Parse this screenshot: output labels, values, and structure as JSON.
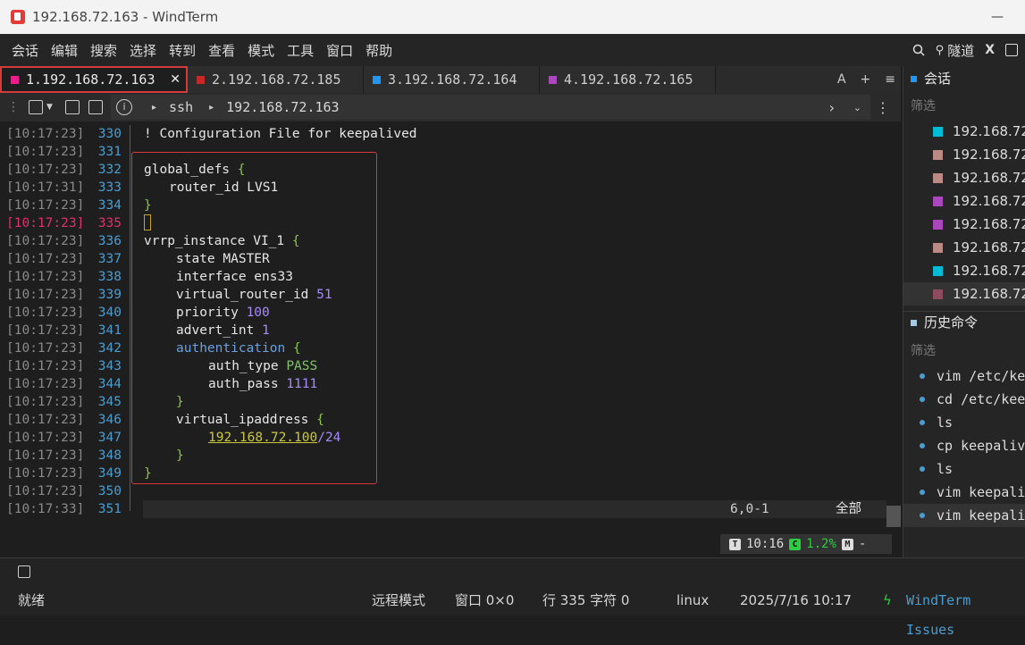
{
  "window": {
    "title": "192.168.72.163 - WindTerm"
  },
  "menu": [
    "会话",
    "编辑",
    "搜索",
    "选择",
    "转到",
    "查看",
    "模式",
    "工具",
    "窗口",
    "帮助"
  ],
  "menu_right": {
    "tunnel_label": "隧道"
  },
  "tabs": [
    {
      "label": "1.192.168.72.163",
      "color": "#e91e8c",
      "active": true
    },
    {
      "label": "2.192.168.72.185",
      "color": "#c62828",
      "active": false
    },
    {
      "label": "3.192.168.72.164",
      "color": "#2196f3",
      "active": false
    },
    {
      "label": "4.192.168.72.165",
      "color": "#ab47bc",
      "active": false
    }
  ],
  "tab_tools": {
    "font": "A",
    "add": "+",
    "menu": "≡"
  },
  "address": {
    "protocol": "ssh",
    "host": "192.168.72.163"
  },
  "terminal": {
    "lines": [
      {
        "ts": "[10:17:23]",
        "ln": "330"
      },
      {
        "ts": "[10:17:23]",
        "ln": "331"
      },
      {
        "ts": "[10:17:23]",
        "ln": "332"
      },
      {
        "ts": "[10:17:31]",
        "ln": "333"
      },
      {
        "ts": "[10:17:23]",
        "ln": "334"
      },
      {
        "ts": "[10:17:23]",
        "ln": "335"
      },
      {
        "ts": "[10:17:23]",
        "ln": "336"
      },
      {
        "ts": "[10:17:23]",
        "ln": "337"
      },
      {
        "ts": "[10:17:23]",
        "ln": "338"
      },
      {
        "ts": "[10:17:23]",
        "ln": "339"
      },
      {
        "ts": "[10:17:23]",
        "ln": "340"
      },
      {
        "ts": "[10:17:23]",
        "ln": "341"
      },
      {
        "ts": "[10:17:23]",
        "ln": "342"
      },
      {
        "ts": "[10:17:23]",
        "ln": "343"
      },
      {
        "ts": "[10:17:23]",
        "ln": "344"
      },
      {
        "ts": "[10:17:23]",
        "ln": "345"
      },
      {
        "ts": "[10:17:23]",
        "ln": "346"
      },
      {
        "ts": "[10:17:23]",
        "ln": "347"
      },
      {
        "ts": "[10:17:23]",
        "ln": "348"
      },
      {
        "ts": "[10:17:23]",
        "ln": "349"
      },
      {
        "ts": "[10:17:23]",
        "ln": "350"
      },
      {
        "ts": "[10:17:33]",
        "ln": "351"
      }
    ],
    "code": {
      "l330": "! Configuration File for keepalived",
      "l332a": "global_defs ",
      "l333": "router_id LVS1",
      "l336a": "vrrp_instance VI_1 ",
      "l337": "state MASTER",
      "l338": "interface ens33",
      "l339a": "virtual_router_id ",
      "l339b": "51",
      "l340a": "priority ",
      "l340b": "100",
      "l341a": "advert_int ",
      "l341b": "1",
      "l342": "authentication",
      "l343a": "auth_type ",
      "l343b": "PASS",
      "l344a": "auth_pass ",
      "l344b": "1111",
      "l346a": "virtual_ipaddress ",
      "l347a": "192.168.72.100",
      "l347b": "/24",
      "open_brace": "{",
      "close_brace": "}"
    },
    "vim_status": {
      "position": "6,0-1",
      "scope": "全部"
    },
    "mini_status": {
      "time": "10:16",
      "cpu": "1.2%",
      "mem": "-"
    }
  },
  "sidebar": {
    "sessions_title": "会话",
    "filter": "筛选",
    "sessions": [
      {
        "label": "192.168.72",
        "color": "#00bcd4"
      },
      {
        "label": "192.168.72",
        "color": "#bc8a84"
      },
      {
        "label": "192.168.72",
        "color": "#bc8a84"
      },
      {
        "label": "192.168.72",
        "color": "#ab47bc"
      },
      {
        "label": "192.168.72",
        "color": "#ab47bc"
      },
      {
        "label": "192.168.72",
        "color": "#bc8a84"
      },
      {
        "label": "192.168.72",
        "color": "#00bcd4"
      },
      {
        "label": "192.168.72",
        "color": "#8e4a5e"
      }
    ],
    "history_title": "历史命令",
    "history": [
      "vim /etc/ke",
      "cd /etc/kee",
      "ls",
      "cp keepaliv",
      "ls",
      "vim keepali",
      "vim keepali"
    ]
  },
  "statusbar": {
    "ready": "就绪",
    "mode": "远程模式",
    "window": "窗口 0×0",
    "cursor": "行 335 字符 0",
    "os": "linux",
    "datetime": "2025/7/16 10:17",
    "issues": "WindTerm Issues"
  }
}
